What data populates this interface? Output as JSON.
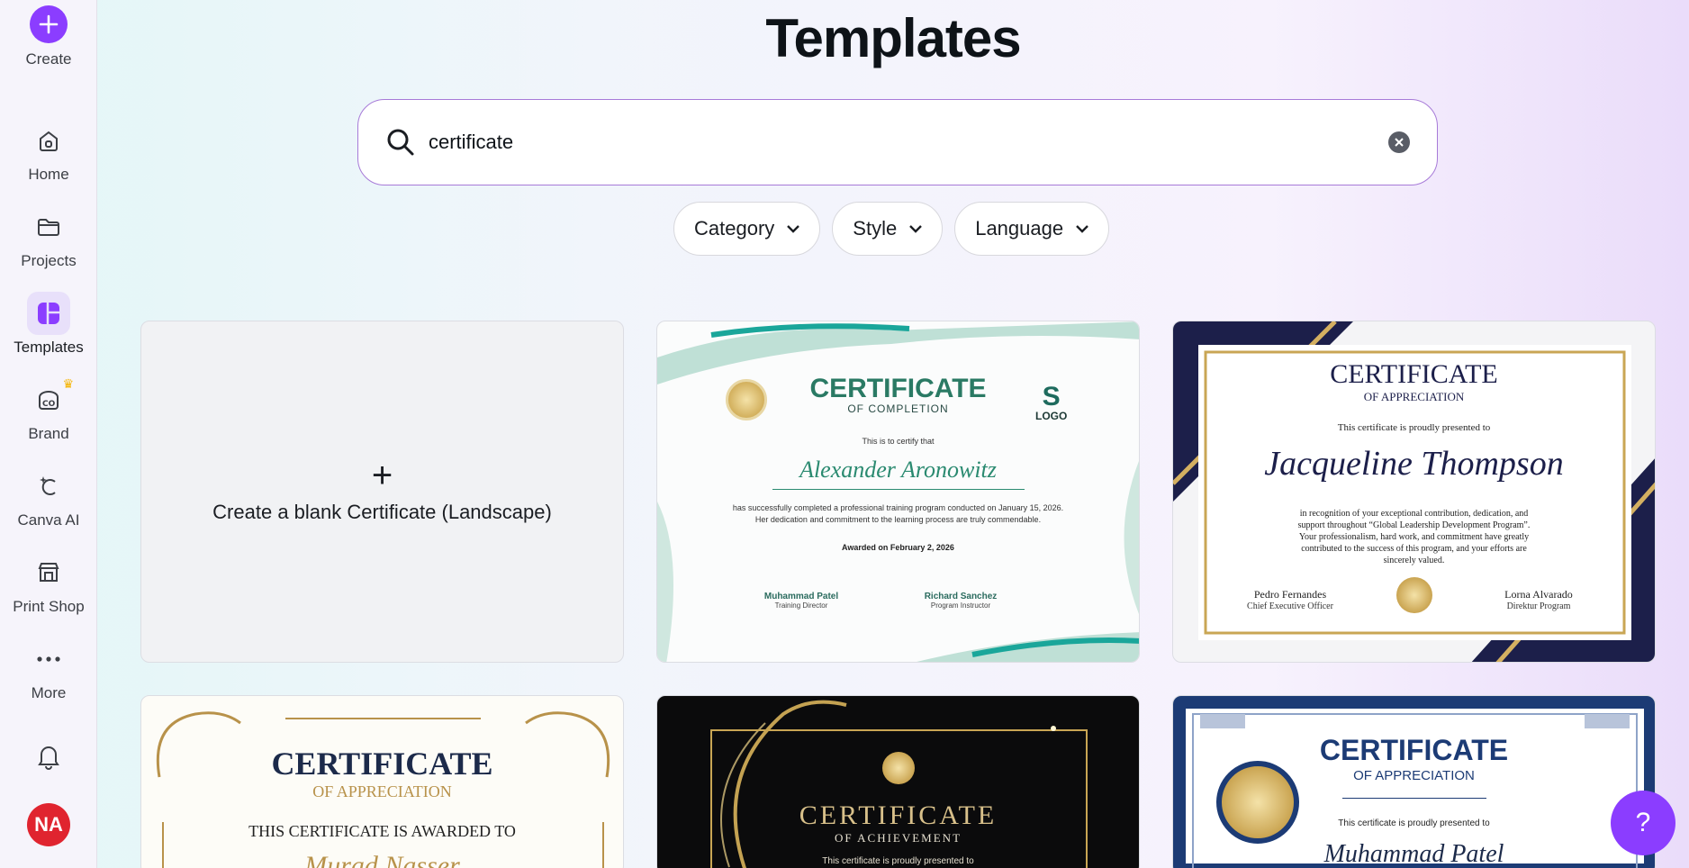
{
  "sidebar": {
    "create_label": "Create",
    "items": [
      {
        "label": "Home",
        "icon": "home-icon"
      },
      {
        "label": "Projects",
        "icon": "folder-icon"
      },
      {
        "label": "Templates",
        "icon": "templates-icon"
      },
      {
        "label": "Brand",
        "icon": "brand-icon"
      },
      {
        "label": "Canva AI",
        "icon": "canva-ai-icon"
      },
      {
        "label": "Print Shop",
        "icon": "print-shop-icon"
      },
      {
        "label": "More",
        "icon": "more-icon"
      }
    ],
    "avatar_initials": "NA"
  },
  "header": {
    "title": "Templates"
  },
  "search": {
    "value": "certificate"
  },
  "filters": [
    {
      "label": "Category"
    },
    {
      "label": "Style"
    },
    {
      "label": "Language"
    }
  ],
  "blank_card": {
    "plus": "+",
    "label": "Create a blank Certificate (Landscape)"
  },
  "templates": [
    {
      "title": "CERTIFICATE",
      "subtitle": "OF COMPLETION",
      "logo": "LOGO",
      "intro": "This is to certify that",
      "name": "Alexander Aronowitz",
      "body1": "has successfully completed a professional training program conducted on January 15, 2026.",
      "body2": "Her dedication and commitment to the learning process are truly commendable.",
      "awarded": "Awarded on February 2, 2026",
      "sig1_name": "Muhammad Patel",
      "sig1_role": "Training Director",
      "sig2_name": "Richard Sanchez",
      "sig2_role": "Program Instructor"
    },
    {
      "title": "CERTIFICATE",
      "subtitle": "OF APPRECIATION",
      "intro": "This certificate is proudly presented to",
      "name": "Jacqueline Thompson",
      "body1": "in recognition of your exceptional contribution, dedication, and",
      "body2": "support throughout “Global Leadership Development Program”.",
      "body3": "Your professionalism, hard work, and commitment have greatly",
      "body4": "contributed to the success of this program, and your efforts are",
      "body5": "sincerely valued.",
      "sig1_name": "Pedro Fernandes",
      "sig1_role": "Chief Executive Officer",
      "sig2_name": "Lorna Alvarado",
      "sig2_role": "Direktur Program"
    },
    {
      "title": "CERTIFICATE",
      "subtitle": "OF APPRECIATION",
      "intro": "THIS CERTIFICATE IS AWARDED TO",
      "name": "Murad Nasser"
    },
    {
      "title": "CERTIFICATE",
      "subtitle": "OF ACHIEVEMENT",
      "intro": "This certificate is proudly presented to"
    },
    {
      "title": "CERTIFICATE",
      "subtitle": "OF APPRECIATION",
      "intro": "This certificate is proudly presented to",
      "name": "Muhammad Patel"
    }
  ],
  "help": {
    "label": "?"
  }
}
